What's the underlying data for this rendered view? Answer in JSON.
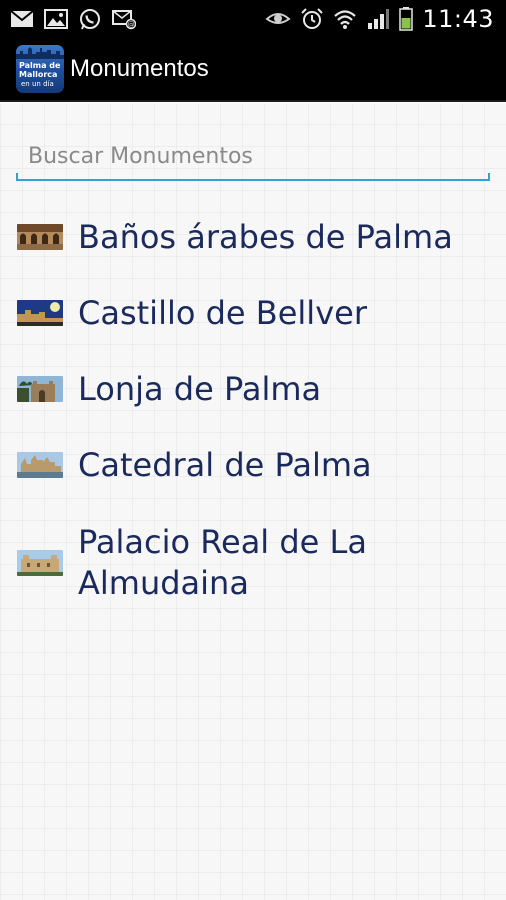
{
  "status_bar": {
    "left_icons": [
      "mail-icon",
      "image-icon",
      "whatsapp-icon",
      "sms-icon"
    ],
    "right_icons": [
      "eye-icon",
      "alarm-icon",
      "wifi-icon",
      "signal-icon",
      "battery-icon"
    ],
    "time": "11:43"
  },
  "app_bar": {
    "logo_text": [
      "Palma de",
      "Mallorca",
      "en un día"
    ],
    "title": "Monumentos"
  },
  "search": {
    "placeholder": "Buscar Monumentos",
    "value": ""
  },
  "monuments": [
    {
      "label": "Baños árabes de Palma",
      "thumb": "arab-baths-thumb"
    },
    {
      "label": "Castillo de Bellver",
      "thumb": "bellver-castle-thumb"
    },
    {
      "label": "Lonja de Palma",
      "thumb": "lonja-thumb"
    },
    {
      "label": "Catedral de Palma",
      "thumb": "cathedral-thumb"
    },
    {
      "label": "Palacio Real de La Almudaina",
      "thumb": "almudaina-palace-thumb"
    }
  ],
  "colors": {
    "accent": "#33a0d8",
    "item_text": "#1b2a5c",
    "bar_background": "#000000"
  }
}
